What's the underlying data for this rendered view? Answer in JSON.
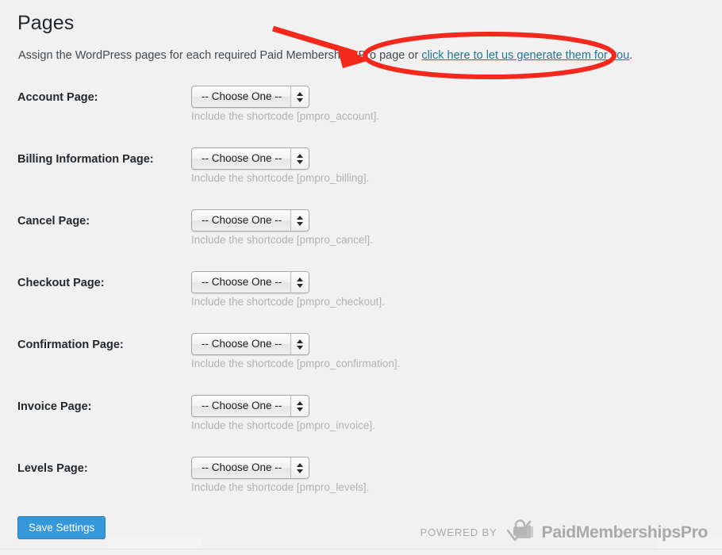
{
  "header": {
    "title": "Pages",
    "intro_before_link": "Assign the WordPress pages for each required Paid Memberships Pro page or ",
    "intro_link": "click here to let us generate them for you",
    "intro_after_link": "."
  },
  "select_placeholder": "-- Choose One --",
  "rows": [
    {
      "label": "Account Page:",
      "value": "-- Choose One --",
      "hint": "Include the shortcode [pmpro_account]."
    },
    {
      "label": "Billing Information Page:",
      "value": "-- Choose One --",
      "hint": "Include the shortcode [pmpro_billing]."
    },
    {
      "label": "Cancel Page:",
      "value": "-- Choose One --",
      "hint": "Include the shortcode [pmpro_cancel]."
    },
    {
      "label": "Checkout Page:",
      "value": "-- Choose One --",
      "hint": "Include the shortcode [pmpro_checkout]."
    },
    {
      "label": "Confirmation Page:",
      "value": "-- Choose One --",
      "hint": "Include the shortcode [pmpro_confirmation]."
    },
    {
      "label": "Invoice Page:",
      "value": "-- Choose One --",
      "hint": "Include the shortcode [pmpro_invoice]."
    },
    {
      "label": "Levels Page:",
      "value": "-- Choose One --",
      "hint": "Include the shortcode [pmpro_levels]."
    }
  ],
  "footer": {
    "save_label": "Save Settings",
    "powered_by_label": "POWERED BY",
    "brand_name": "PaidMembershipsPro"
  },
  "colors": {
    "background": "#f1f1f1",
    "heading_text": "#23282d",
    "link": "#21759b",
    "hint_text": "#b2b2b2",
    "save_button": "#3498db",
    "save_button_border": "#2980b9",
    "annotation_red": "#f5281e",
    "brand_gray": "#a9a9a9"
  },
  "annotations": {
    "arrow_name": "red-arrow-pointing-to-link",
    "ellipse_name": "red-ellipse-around-link"
  }
}
